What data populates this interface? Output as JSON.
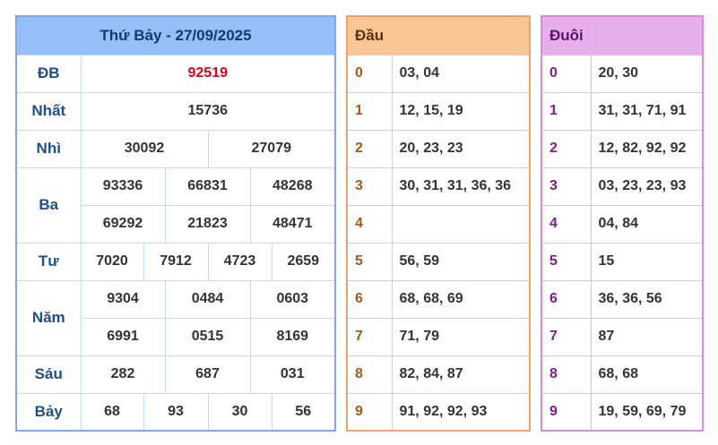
{
  "results": {
    "title": "Thứ Bảy - 27/09/2025",
    "rows": [
      {
        "label": "ĐB",
        "values": [
          "92519"
        ]
      },
      {
        "label": "Nhất",
        "values": [
          "15736"
        ]
      },
      {
        "label": "Nhì",
        "values": [
          "30092",
          "27079"
        ]
      },
      {
        "label": "Ba",
        "values": [
          "93336",
          "66831",
          "48268",
          "69292",
          "21823",
          "48471"
        ]
      },
      {
        "label": "Tư",
        "values": [
          "7020",
          "7912",
          "4723",
          "2659"
        ]
      },
      {
        "label": "Năm",
        "values": [
          "9304",
          "0484",
          "0603",
          "6991",
          "0515",
          "8169"
        ]
      },
      {
        "label": "Sáu",
        "values": [
          "282",
          "687",
          "031"
        ]
      },
      {
        "label": "Bảy",
        "values": [
          "68",
          "93",
          "30",
          "56"
        ]
      }
    ]
  },
  "dau": {
    "header": "Đầu",
    "rows": [
      {
        "key": "0",
        "values": "03, 04"
      },
      {
        "key": "1",
        "values": "12, 15, 19"
      },
      {
        "key": "2",
        "values": "20, 23, 23"
      },
      {
        "key": "3",
        "values": "30, 31, 31, 36, 36"
      },
      {
        "key": "4",
        "values": ""
      },
      {
        "key": "5",
        "values": "56, 59"
      },
      {
        "key": "6",
        "values": "68, 68, 69"
      },
      {
        "key": "7",
        "values": "71, 79"
      },
      {
        "key": "8",
        "values": "82, 84, 87"
      },
      {
        "key": "9",
        "values": "91, 92, 92, 93"
      }
    ]
  },
  "duoi": {
    "header": "Đuôi",
    "rows": [
      {
        "key": "0",
        "values": "20, 30"
      },
      {
        "key": "1",
        "values": "31, 31, 71, 91"
      },
      {
        "key": "2",
        "values": "12, 82, 92, 92"
      },
      {
        "key": "3",
        "values": "03, 23, 23, 93"
      },
      {
        "key": "4",
        "values": "04, 84"
      },
      {
        "key": "5",
        "values": "15"
      },
      {
        "key": "6",
        "values": "36, 36, 56"
      },
      {
        "key": "7",
        "values": "87"
      },
      {
        "key": "8",
        "values": "68, 68"
      },
      {
        "key": "9",
        "values": "19, 59, 69, 79"
      }
    ]
  },
  "colors": {
    "special_prize": "#e4001b",
    "results_header": "#95bff8",
    "dau_header": "#f9c696",
    "duoi_header": "#e7aeec"
  }
}
